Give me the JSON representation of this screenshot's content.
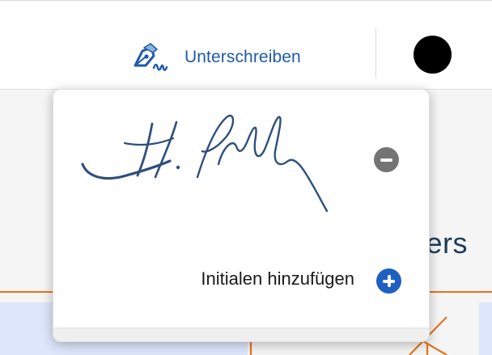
{
  "toolbar": {
    "sign_label": "Unterschreiben",
    "sign_icon": "pen-signature-icon",
    "sign_color": "#1f5aa8",
    "selected_color": "#000000"
  },
  "document": {
    "heading_fragment": "ters",
    "accent_color": "#e8731a"
  },
  "popover": {
    "signature_image": "handwritten-signature",
    "remove_icon": "minus-circle-icon",
    "add_initials_label": "Initialen hinzufügen",
    "add_icon": "plus-circle-icon",
    "add_icon_color": "#1f5fc2"
  }
}
